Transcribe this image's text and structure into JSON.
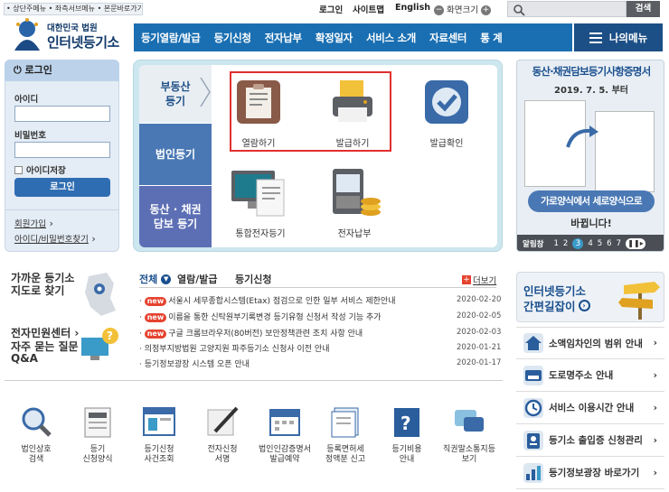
{
  "topbar": {
    "skip_links": "• 상단주메뉴 • 좌측서브메뉴 • 본문바로가기",
    "login": "로그인",
    "sitemap": "사이트맵",
    "english": "English",
    "font_size": "화면크기",
    "search_button": "검색"
  },
  "logo": {
    "subtitle": "대한민국 법원",
    "title": "인터넷등기소"
  },
  "nav": {
    "items": [
      "등기열람/발급",
      "등기신청",
      "전자납부",
      "확정일자",
      "서비스 소개",
      "자료센터",
      "통 계"
    ],
    "my_menu": "나의메뉴"
  },
  "login_box": {
    "title": "로그인",
    "id_label": "아이디",
    "password_label": "비밀번호",
    "save_id": "아이디저장",
    "login_button": "로그인",
    "join": "회원가입",
    "find": "아이디/비밀번호찾기"
  },
  "categories": [
    {
      "label": "부동산\n등기"
    },
    {
      "label": "법인등기"
    },
    {
      "label": "동산 · 채권\n담보 등기"
    }
  ],
  "services": {
    "view": "열람하기",
    "issue": "발급하기",
    "confirm": "발급확인",
    "integrated": "통합전자등기",
    "payment": "전자납부"
  },
  "banner": {
    "title": "동산·채권담보등기사항증명서",
    "date": "2019. 7. 5. 부터",
    "msg1": "가로양식에서 세로양식으로",
    "msg2": "바뀝니다!",
    "alarm": "알림창",
    "pages": [
      "1",
      "2",
      "3",
      "4",
      "5",
      "6",
      "7"
    ],
    "current_page": "3"
  },
  "left_links": {
    "nearest": "가까운 등기소\n지도로 찾기",
    "civil_center": "전자민원센터",
    "faq": "자주 묻는 질문\nQ&A"
  },
  "news": {
    "tabs": [
      "전체",
      "열람/발급",
      "등기신청"
    ],
    "more": "더보기",
    "items": [
      {
        "new": true,
        "text": "서울시 세무종합시스템(Etax) 점검으로 인한 일부 서비스 제한안내",
        "date": "2020-02-20"
      },
      {
        "new": true,
        "text": "이름을 통한 신탁원부기록변경 등기유형 신청서 작성 기능 추가",
        "date": "2020-02-05"
      },
      {
        "new": true,
        "text": "구글 크롬브라우저(80버전) 보안정책관련 조치 사항 안내",
        "date": "2020-02-03"
      },
      {
        "new": false,
        "text": "의정부지방법원 고양지원 파주등기소 신청사 이전 안내",
        "date": "2020-01-21"
      },
      {
        "new": false,
        "text": "등기정보광장 시스템 오픈 안내",
        "date": "2020-01-17"
      }
    ],
    "new_badge": "new"
  },
  "guide_banner": {
    "line1": "인터넷등기소",
    "line2": "간편길잡이"
  },
  "quick_icons": [
    {
      "label": "법인상호\n검색"
    },
    {
      "label": "등기\n신청양식"
    },
    {
      "label": "등기신청\n사건조회"
    },
    {
      "label": "전자신청\n서명"
    },
    {
      "label": "법인인감증명서\n발급예약"
    },
    {
      "label": "등록면허세\n정액분 신고"
    },
    {
      "label": "등기비용\n안내"
    },
    {
      "label": "직권말소통지등\n보기"
    }
  ],
  "right_list": [
    {
      "label": "소액임차인의 범위 안내"
    },
    {
      "label": "도로명주소 안내"
    },
    {
      "label": "서비스 이용시간 안내"
    },
    {
      "label": "등기소 출입증 신청관리"
    },
    {
      "label": "등기정보광장 바로가기"
    }
  ],
  "colors": {
    "nav_blue": "#1a6fb2",
    "dark_navy": "#1c4f86",
    "red_box": "#e03030",
    "new_red": "#e5432f"
  }
}
